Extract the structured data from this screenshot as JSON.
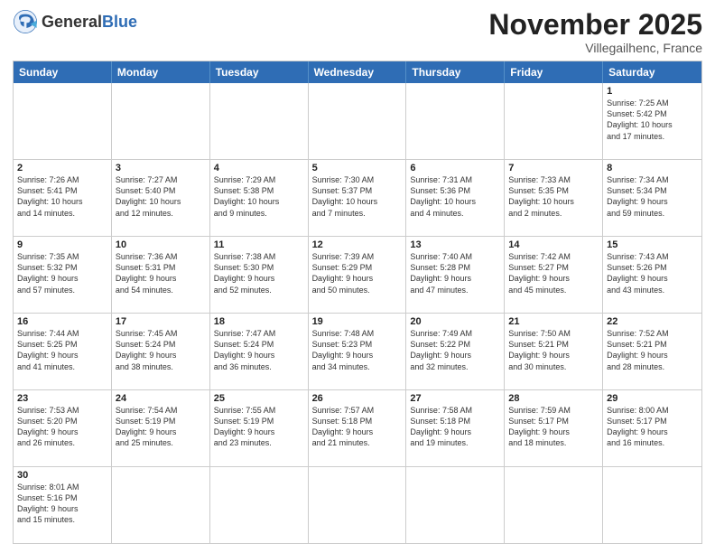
{
  "header": {
    "logo_general": "General",
    "logo_blue": "Blue",
    "month_title": "November 2025",
    "location": "Villegailhenc, France"
  },
  "days_of_week": [
    "Sunday",
    "Monday",
    "Tuesday",
    "Wednesday",
    "Thursday",
    "Friday",
    "Saturday"
  ],
  "weeks": [
    [
      {
        "day": "",
        "info": ""
      },
      {
        "day": "",
        "info": ""
      },
      {
        "day": "",
        "info": ""
      },
      {
        "day": "",
        "info": ""
      },
      {
        "day": "",
        "info": ""
      },
      {
        "day": "",
        "info": ""
      },
      {
        "day": "1",
        "info": "Sunrise: 7:25 AM\nSunset: 5:42 PM\nDaylight: 10 hours\nand 17 minutes."
      }
    ],
    [
      {
        "day": "2",
        "info": "Sunrise: 7:26 AM\nSunset: 5:41 PM\nDaylight: 10 hours\nand 14 minutes."
      },
      {
        "day": "3",
        "info": "Sunrise: 7:27 AM\nSunset: 5:40 PM\nDaylight: 10 hours\nand 12 minutes."
      },
      {
        "day": "4",
        "info": "Sunrise: 7:29 AM\nSunset: 5:38 PM\nDaylight: 10 hours\nand 9 minutes."
      },
      {
        "day": "5",
        "info": "Sunrise: 7:30 AM\nSunset: 5:37 PM\nDaylight: 10 hours\nand 7 minutes."
      },
      {
        "day": "6",
        "info": "Sunrise: 7:31 AM\nSunset: 5:36 PM\nDaylight: 10 hours\nand 4 minutes."
      },
      {
        "day": "7",
        "info": "Sunrise: 7:33 AM\nSunset: 5:35 PM\nDaylight: 10 hours\nand 2 minutes."
      },
      {
        "day": "8",
        "info": "Sunrise: 7:34 AM\nSunset: 5:34 PM\nDaylight: 9 hours\nand 59 minutes."
      }
    ],
    [
      {
        "day": "9",
        "info": "Sunrise: 7:35 AM\nSunset: 5:32 PM\nDaylight: 9 hours\nand 57 minutes."
      },
      {
        "day": "10",
        "info": "Sunrise: 7:36 AM\nSunset: 5:31 PM\nDaylight: 9 hours\nand 54 minutes."
      },
      {
        "day": "11",
        "info": "Sunrise: 7:38 AM\nSunset: 5:30 PM\nDaylight: 9 hours\nand 52 minutes."
      },
      {
        "day": "12",
        "info": "Sunrise: 7:39 AM\nSunset: 5:29 PM\nDaylight: 9 hours\nand 50 minutes."
      },
      {
        "day": "13",
        "info": "Sunrise: 7:40 AM\nSunset: 5:28 PM\nDaylight: 9 hours\nand 47 minutes."
      },
      {
        "day": "14",
        "info": "Sunrise: 7:42 AM\nSunset: 5:27 PM\nDaylight: 9 hours\nand 45 minutes."
      },
      {
        "day": "15",
        "info": "Sunrise: 7:43 AM\nSunset: 5:26 PM\nDaylight: 9 hours\nand 43 minutes."
      }
    ],
    [
      {
        "day": "16",
        "info": "Sunrise: 7:44 AM\nSunset: 5:25 PM\nDaylight: 9 hours\nand 41 minutes."
      },
      {
        "day": "17",
        "info": "Sunrise: 7:45 AM\nSunset: 5:24 PM\nDaylight: 9 hours\nand 38 minutes."
      },
      {
        "day": "18",
        "info": "Sunrise: 7:47 AM\nSunset: 5:24 PM\nDaylight: 9 hours\nand 36 minutes."
      },
      {
        "day": "19",
        "info": "Sunrise: 7:48 AM\nSunset: 5:23 PM\nDaylight: 9 hours\nand 34 minutes."
      },
      {
        "day": "20",
        "info": "Sunrise: 7:49 AM\nSunset: 5:22 PM\nDaylight: 9 hours\nand 32 minutes."
      },
      {
        "day": "21",
        "info": "Sunrise: 7:50 AM\nSunset: 5:21 PM\nDaylight: 9 hours\nand 30 minutes."
      },
      {
        "day": "22",
        "info": "Sunrise: 7:52 AM\nSunset: 5:21 PM\nDaylight: 9 hours\nand 28 minutes."
      }
    ],
    [
      {
        "day": "23",
        "info": "Sunrise: 7:53 AM\nSunset: 5:20 PM\nDaylight: 9 hours\nand 26 minutes."
      },
      {
        "day": "24",
        "info": "Sunrise: 7:54 AM\nSunset: 5:19 PM\nDaylight: 9 hours\nand 25 minutes."
      },
      {
        "day": "25",
        "info": "Sunrise: 7:55 AM\nSunset: 5:19 PM\nDaylight: 9 hours\nand 23 minutes."
      },
      {
        "day": "26",
        "info": "Sunrise: 7:57 AM\nSunset: 5:18 PM\nDaylight: 9 hours\nand 21 minutes."
      },
      {
        "day": "27",
        "info": "Sunrise: 7:58 AM\nSunset: 5:18 PM\nDaylight: 9 hours\nand 19 minutes."
      },
      {
        "day": "28",
        "info": "Sunrise: 7:59 AM\nSunset: 5:17 PM\nDaylight: 9 hours\nand 18 minutes."
      },
      {
        "day": "29",
        "info": "Sunrise: 8:00 AM\nSunset: 5:17 PM\nDaylight: 9 hours\nand 16 minutes."
      }
    ],
    [
      {
        "day": "30",
        "info": "Sunrise: 8:01 AM\nSunset: 5:16 PM\nDaylight: 9 hours\nand 15 minutes."
      },
      {
        "day": "",
        "info": ""
      },
      {
        "day": "",
        "info": ""
      },
      {
        "day": "",
        "info": ""
      },
      {
        "day": "",
        "info": ""
      },
      {
        "day": "",
        "info": ""
      },
      {
        "day": "",
        "info": ""
      }
    ]
  ]
}
